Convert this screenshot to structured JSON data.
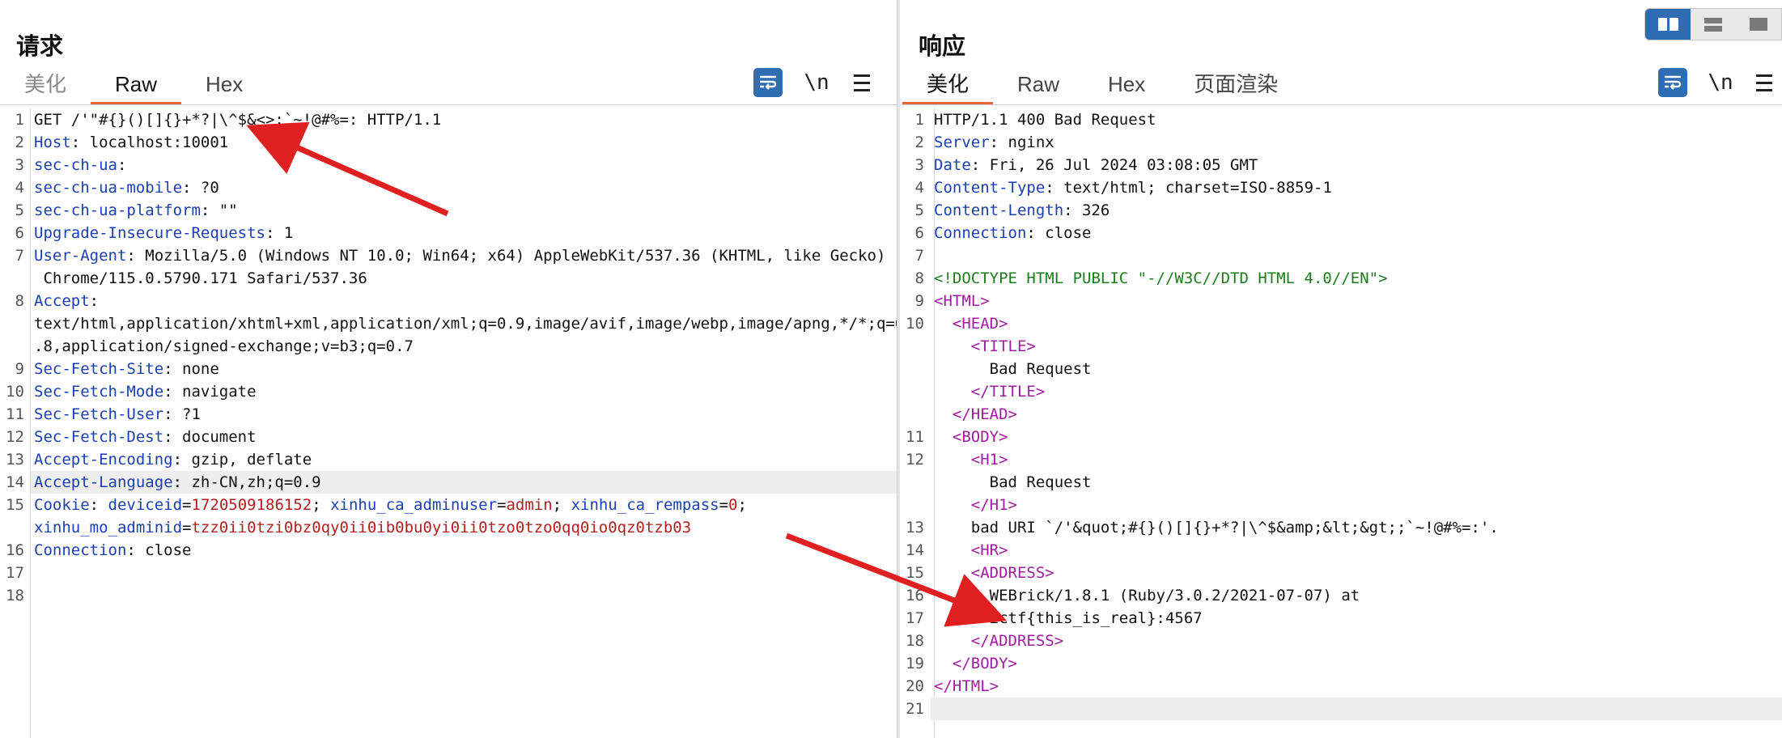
{
  "request": {
    "title": "请求",
    "tabs": [
      "美化",
      "Raw",
      "Hex"
    ],
    "active_tab": "Raw",
    "newline_label": "\\n",
    "lines": [
      {
        "n": "1",
        "parts": [
          [
            "v",
            "GET /'\"#{}()[]{}+*?|\\^$&<>;`~!@#%=: HTTP/1.1"
          ]
        ]
      },
      {
        "n": "2",
        "parts": [
          [
            "k",
            "Host"
          ],
          [
            "v",
            ": localhost:10001"
          ]
        ]
      },
      {
        "n": "3",
        "parts": [
          [
            "k",
            "sec-ch-ua"
          ],
          [
            "v",
            ":"
          ]
        ]
      },
      {
        "n": "4",
        "parts": [
          [
            "k",
            "sec-ch-ua-mobile"
          ],
          [
            "v",
            ": ?0"
          ]
        ]
      },
      {
        "n": "5",
        "parts": [
          [
            "k",
            "sec-ch-ua-platform"
          ],
          [
            "v",
            ": \"\""
          ]
        ]
      },
      {
        "n": "6",
        "parts": [
          [
            "k",
            "Upgrade-Insecure-Requests"
          ],
          [
            "v",
            ": 1"
          ]
        ]
      },
      {
        "n": "7",
        "parts": [
          [
            "k",
            "User-Agent"
          ],
          [
            "v",
            ": Mozilla/5.0 (Windows NT 10.0; Win64; x64) AppleWebKit/537.36 (KHTML, like Gecko)"
          ]
        ]
      },
      {
        "n": "",
        "parts": [
          [
            "v",
            " Chrome/115.0.5790.171 Safari/537.36"
          ]
        ]
      },
      {
        "n": "8",
        "parts": [
          [
            "k",
            "Accept"
          ],
          [
            "v",
            ":"
          ]
        ]
      },
      {
        "n": "",
        "parts": [
          [
            "v",
            "text/html,application/xhtml+xml,application/xml;q=0.9,image/avif,image/webp,image/apng,*/*;q=0"
          ]
        ]
      },
      {
        "n": "",
        "parts": [
          [
            "v",
            ".8,application/signed-exchange;v=b3;q=0.7"
          ]
        ]
      },
      {
        "n": "9",
        "parts": [
          [
            "k",
            "Sec-Fetch-Site"
          ],
          [
            "v",
            ": none"
          ]
        ]
      },
      {
        "n": "10",
        "parts": [
          [
            "k",
            "Sec-Fetch-Mode"
          ],
          [
            "v",
            ": navigate"
          ]
        ]
      },
      {
        "n": "11",
        "parts": [
          [
            "k",
            "Sec-Fetch-User"
          ],
          [
            "v",
            ": ?1"
          ]
        ]
      },
      {
        "n": "12",
        "parts": [
          [
            "k",
            "Sec-Fetch-Dest"
          ],
          [
            "v",
            ": document"
          ]
        ]
      },
      {
        "n": "13",
        "parts": [
          [
            "k",
            "Accept-Encoding"
          ],
          [
            "v",
            ": gzip, deflate"
          ]
        ]
      },
      {
        "n": "14",
        "hl": true,
        "parts": [
          [
            "k",
            "Accept-Language"
          ],
          [
            "v",
            ": zh-CN,zh;q=0.9"
          ]
        ]
      },
      {
        "n": "15",
        "parts": [
          [
            "k",
            "Cookie"
          ],
          [
            "v",
            ": "
          ],
          [
            "k",
            "deviceid"
          ],
          [
            "v",
            "="
          ],
          [
            "cv",
            "1720509186152"
          ],
          [
            "v",
            "; "
          ],
          [
            "k",
            "xinhu_ca_adminuser"
          ],
          [
            "v",
            "="
          ],
          [
            "cv",
            "admin"
          ],
          [
            "v",
            "; "
          ],
          [
            "k",
            "xinhu_ca_rempass"
          ],
          [
            "v",
            "="
          ],
          [
            "cv",
            "0"
          ],
          [
            "v",
            ";"
          ]
        ]
      },
      {
        "n": "",
        "parts": [
          [
            "k",
            "xinhu_mo_adminid"
          ],
          [
            "v",
            "="
          ],
          [
            "cv",
            "tzz0ii0tzi0bz0qy0ii0ib0bu0yi0ii0tzo0tzo0qq0io0qz0tzb03"
          ]
        ]
      },
      {
        "n": "16",
        "parts": [
          [
            "k",
            "Connection"
          ],
          [
            "v",
            ": close"
          ]
        ]
      },
      {
        "n": "17",
        "parts": []
      },
      {
        "n": "18",
        "parts": []
      }
    ]
  },
  "response": {
    "title": "响应",
    "tabs": [
      "美化",
      "Raw",
      "Hex",
      "页面渲染"
    ],
    "active_tab": "美化",
    "newline_label": "\\n",
    "lines": [
      {
        "n": "1",
        "parts": [
          [
            "v",
            "HTTP/1.1 400 Bad Request"
          ]
        ]
      },
      {
        "n": "2",
        "parts": [
          [
            "k",
            "Server"
          ],
          [
            "v",
            ": nginx"
          ]
        ]
      },
      {
        "n": "3",
        "parts": [
          [
            "k",
            "Date"
          ],
          [
            "v",
            ": Fri, 26 Jul 2024 03:08:05 GMT"
          ]
        ]
      },
      {
        "n": "4",
        "parts": [
          [
            "k",
            "Content-Type"
          ],
          [
            "v",
            ": text/html; charset=ISO-8859-1"
          ]
        ]
      },
      {
        "n": "5",
        "parts": [
          [
            "k",
            "Content-Length"
          ],
          [
            "v",
            ": 326"
          ]
        ]
      },
      {
        "n": "6",
        "parts": [
          [
            "k",
            "Connection"
          ],
          [
            "v",
            ": close"
          ]
        ]
      },
      {
        "n": "7",
        "parts": []
      },
      {
        "n": "8",
        "parts": [
          [
            "doc",
            "<!DOCTYPE HTML PUBLIC \"-//W3C//DTD HTML 4.0//EN\">"
          ]
        ]
      },
      {
        "n": "9",
        "parts": [
          [
            "tag",
            "<HTML>"
          ]
        ]
      },
      {
        "n": "10",
        "parts": [
          [
            "v",
            "  "
          ],
          [
            "tag",
            "<HEAD>"
          ]
        ]
      },
      {
        "n": "",
        "parts": [
          [
            "v",
            "    "
          ],
          [
            "tag",
            "<TITLE>"
          ]
        ]
      },
      {
        "n": "",
        "parts": [
          [
            "v",
            "      Bad Request"
          ]
        ]
      },
      {
        "n": "",
        "parts": [
          [
            "v",
            "    "
          ],
          [
            "tag",
            "</TITLE>"
          ]
        ]
      },
      {
        "n": "",
        "parts": [
          [
            "v",
            "  "
          ],
          [
            "tag",
            "</HEAD>"
          ]
        ]
      },
      {
        "n": "11",
        "parts": [
          [
            "v",
            "  "
          ],
          [
            "tag",
            "<BODY>"
          ]
        ]
      },
      {
        "n": "12",
        "parts": [
          [
            "v",
            "    "
          ],
          [
            "tag",
            "<H1>"
          ]
        ]
      },
      {
        "n": "",
        "parts": [
          [
            "v",
            "      Bad Request"
          ]
        ]
      },
      {
        "n": "",
        "parts": [
          [
            "v",
            "    "
          ],
          [
            "tag",
            "</H1>"
          ]
        ]
      },
      {
        "n": "13",
        "parts": [
          [
            "v",
            "    bad URI `/'&quot;#{}()[]{}+*?|\\^$&amp;&lt;&gt;;`~!@#%=:'."
          ]
        ]
      },
      {
        "n": "14",
        "parts": [
          [
            "v",
            "    "
          ],
          [
            "tag",
            "<HR>"
          ]
        ]
      },
      {
        "n": "15",
        "parts": [
          [
            "v",
            "    "
          ],
          [
            "tag",
            "<ADDRESS>"
          ]
        ]
      },
      {
        "n": "16",
        "parts": [
          [
            "v",
            "      WEBrick/1.8.1 (Ruby/3.0.2/2021-07-07) at"
          ]
        ]
      },
      {
        "n": "17",
        "parts": [
          [
            "v",
            "      ictf{this_is_real}:4567"
          ]
        ]
      },
      {
        "n": "18",
        "parts": [
          [
            "v",
            "    "
          ],
          [
            "tag",
            "</ADDRESS>"
          ]
        ]
      },
      {
        "n": "19",
        "parts": [
          [
            "v",
            "  "
          ],
          [
            "tag",
            "</BODY>"
          ]
        ]
      },
      {
        "n": "20",
        "parts": [
          [
            "tag",
            "</HTML>"
          ]
        ]
      },
      {
        "n": "21",
        "hl": true,
        "parts": []
      }
    ]
  },
  "view_switch": {
    "options": [
      "split-horizontal",
      "split-vertical",
      "single"
    ],
    "active": "split-horizontal"
  },
  "icons": {
    "wrap": "wrap-lines-icon",
    "menu": "hamburger-menu-icon"
  },
  "colors": {
    "accent": "#e8623a",
    "header_key": "#1b3fb0",
    "cookie_value": "#b21f1f",
    "html_tag": "#a11ca1",
    "doctype": "#1e7b1e",
    "button_blue": "#2f6db3",
    "arrow": "#e02020"
  }
}
